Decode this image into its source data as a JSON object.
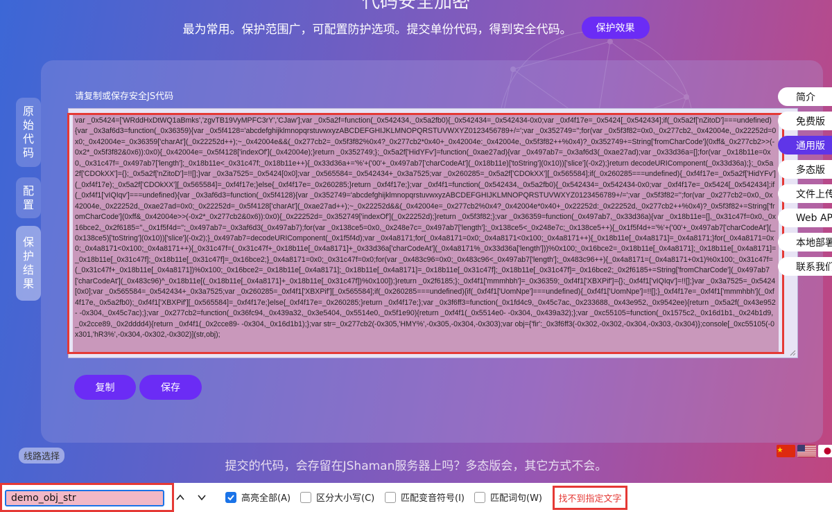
{
  "header": {
    "title_partial": "代码安全加密",
    "subtitle": "最为常用。保护范围广，可配置防护选项。提交单份代码，得到安全代码。",
    "effect_button": "保护效果"
  },
  "left_tabs": [
    {
      "label": "原始代码"
    },
    {
      "label": "配置"
    },
    {
      "label": "保护结果",
      "active": true
    }
  ],
  "panel": {
    "label": "请复制或保存安全JS代码",
    "code": "var _0x5424=['WRddHxDtWQ1aBmks','zgvTB19VyMPFC3rY','CJaw'];var _0x5a2f=function(_0x542434,_0x5a2fb0){_0x542434=_0x542434-0x0;var _0xf4f17e=_0x5424[_0x542434];if(_0x5a2f['nZitoD']===undefined){var _0x3af6d3=function(_0x36359){var _0x5f4128='abcdefghijklmnopqrstuvwxyzABCDEFGHIJKLMNOPQRSTUVWXYZ0123456789+/=';var _0x352749='';for(var _0x5f3f82=0x0,_0x277cb2,_0x42004e,_0x22252d=0x0;_0x42004e=_0x36359['charAt'](_0x22252d++);~_0x42004e&&(_0x277cb2=_0x5f3f82%0x4?_0x277cb2*0x40+_0x42004e:_0x42004e,_0x5f3f82++%0x4)?_0x352749+=String['fromCharCode'](0xff&_0x277cb2>>(-0x2*_0x5f3f82&0x6)):0x0){_0x42004e=_0x5f4128['indexOf'](_0x42004e);}return _0x352749;};_0x5a2f['HidYFv']=function(_0xae27ad){var _0x497ab7=_0x3af6d3(_0xae27ad);var _0x33d36a=[];for(var _0x18b11e=0x0,_0x31c47f=_0x497ab7['length'];_0x18b11e<_0x31c47f;_0x18b11e++){_0x33d36a+='%'+('00'+_0x497ab7['charCodeAt'](_0x18b11e)['toString'](0x10))['slice'](-0x2);}return decodeURIComponent(_0x33d36a);};_0x5a2f['CDOkXX']={};_0x5a2f['nZitoD']=!![];}var _0x3a7525=_0x5424[0x0];var _0x565584=_0x542434+_0x3a7525;var _0x260285=_0x5a2f['CDOkXX'][_0x565584];if(_0x260285===undefined){_0xf4f17e=_0x5a2f['HidYFv'](_0xf4f17e);_0x5a2f['CDOkXX'][_0x565584]=_0xf4f17e;}else{_0xf4f17e=_0x260285;}return _0xf4f17e;};var _0xf4f1=function(_0x542434,_0x5a2fb0){_0x542434=_0x542434-0x0;var _0xf4f17e=_0x5424[_0x542434];if(_0xf4f1['vIQIqv']===undefined){var _0x3af6d3=function(_0x5f4128){var _0x352749='abcdefghijklmnopqrstuvwxyzABCDEFGHIJKLMNOPQRSTUVWXYZ0123456789+/=';var _0x5f3f82='';for(var _0x277cb2=0x0,_0x42004e,_0x22252d,_0xae27ad=0x0;_0x22252d=_0x5f4128['charAt'](_0xae27ad++);~_0x22252d&&(_0x42004e=_0x277cb2%0x4?_0x42004e*0x40+_0x22252d:_0x22252d,_0x277cb2++%0x4)?_0x5f3f82+=String['fromCharCode'](0xff&_0x42004e>>(-0x2*_0x277cb2&0x6)):0x0){_0x22252d=_0x352749['indexOf'](_0x22252d);}return _0x5f3f82;};var _0x36359=function(_0x497ab7,_0x33d36a){var _0x18b11e=[],_0x31c47f=0x0,_0x16bce2,_0x2f6185='',_0x1f5f4d='';_0x497ab7=_0x3af6d3(_0x497ab7);for(var _0x138ce5=0x0,_0x248e7c=_0x497ab7['length'];_0x138ce5<_0x248e7c;_0x138ce5++){_0x1f5f4d+='%'+('00'+_0x497ab7['charCodeAt'](_0x138ce5)['toString'](0x10))['slice'](-0x2);}_0x497ab7=decodeURIComponent(_0x1f5f4d);var _0x4a8171;for(_0x4a8171=0x0;_0x4a8171<0x100;_0x4a8171++){_0x18b11e[_0x4a8171]=_0x4a8171;}for(_0x4a8171=0x0;_0x4a8171<0x100;_0x4a8171++){_0x31c47f=(_0x31c47f+_0x18b11e[_0x4a8171]+_0x33d36a['charCodeAt'](_0x4a8171%_0x33d36a['length']))%0x100;_0x16bce2=_0x18b11e[_0x4a8171];_0x18b11e[_0x4a8171]=_0x18b11e[_0x31c47f];_0x18b11e[_0x31c47f]=_0x16bce2;}_0x4a8171=0x0;_0x31c47f=0x0;for(var _0x483c96=0x0;_0x483c96<_0x497ab7['length'];_0x483c96++){_0x4a8171=(_0x4a8171+0x1)%0x100;_0x31c47f=(_0x31c47f+_0x18b11e[_0x4a8171])%0x100;_0x16bce2=_0x18b11e[_0x4a8171];_0x18b11e[_0x4a8171]=_0x18b11e[_0x31c47f];_0x18b11e[_0x31c47f]=_0x16bce2;_0x2f6185+=String['fromCharCode'](_0x497ab7['charCodeAt'](_0x483c96)^_0x18b11e[(_0x18b11e[_0x4a8171]+_0x18b11e[_0x31c47f])%0x100]);}return _0x2f6185;};_0xf4f1['mmmhbh']=_0x36359;_0xf4f1['XBXPif']={};_0xf4f1['vIQIqv']=!![];}var _0x3a7525=_0x5424[0x0];var _0x565584=_0x542434+_0x3a7525;var _0x260285=_0xf4f1['XBXPif'][_0x565584];if(_0x260285===undefined){if(_0xf4f1['UomNpe']===undefined){_0xf4f1['UomNpe']=!![];}_0xf4f17e=_0xf4f1['mmmhbh'](_0xf4f17e,_0x5a2fb0);_0xf4f1['XBXPif'][_0x565584]=_0xf4f17e;}else{_0xf4f17e=_0x260285;}return _0xf4f17e;};var _0x3f6ff3=function(_0x1fd4c9,_0x45c7ac,_0x233688,_0x43e952,_0x9542ee){return _0x5a2f(_0x43e952- -0x304,_0x45c7ac);};var _0x277cb2=function(_0x36fc94,_0x439a32,_0x3e5404,_0x5514e0,_0x5f1e90){return _0xf4f1(_0x5514e0- -0x304,_0x439a32);};var _0xc55105=function(_0x1575c2,_0x16d1b1,_0x24b1d9,_0x2cce89,_0x2dddd4){return _0xf4f1(_0x2cce89- -0x304,_0x16d1b1);};var str=_0x277cb2(-0x305,'HMY%',-0x305,-0x304,-0x303);var obj={'fir':_0x3f6ff3(-0x302,-0x302,-0x304,-0x303,-0x304)};console[_0xc55105(-0x301,'hR3%',-0x304,-0x302,-0x302)](str,obj);",
    "copy_button": "复制",
    "save_button": "保存"
  },
  "right_nav": [
    {
      "label": "简介"
    },
    {
      "label": "免费版"
    },
    {
      "label": "通用版",
      "active": true
    },
    {
      "label": "多态版"
    },
    {
      "label": "文件上传"
    },
    {
      "label": "Web API"
    },
    {
      "label": "本地部署"
    },
    {
      "label": "联系我们"
    }
  ],
  "footer": {
    "route_button": "线路选择",
    "text": "提交的代码，会存留在JShaman服务器上吗？多态版会，其它方式不会。"
  },
  "flags": [
    "china-flag",
    "usa-flag",
    "japan-flag"
  ],
  "findbar": {
    "query": "demo_obj_str",
    "options": [
      {
        "label": "高亮全部(A)",
        "checked": true
      },
      {
        "label": "区分大小写(C)",
        "checked": false
      },
      {
        "label": "匹配变音符号(I)",
        "checked": false
      },
      {
        "label": "匹配词句(W)",
        "checked": false
      }
    ],
    "status": "找不到指定文字"
  },
  "colors": {
    "accent": "#6b2cf5",
    "active_nav": "#5f35e8",
    "error": "#e53935",
    "find_highlight": "#f2b8c6",
    "code_selection": "#c998bb"
  }
}
